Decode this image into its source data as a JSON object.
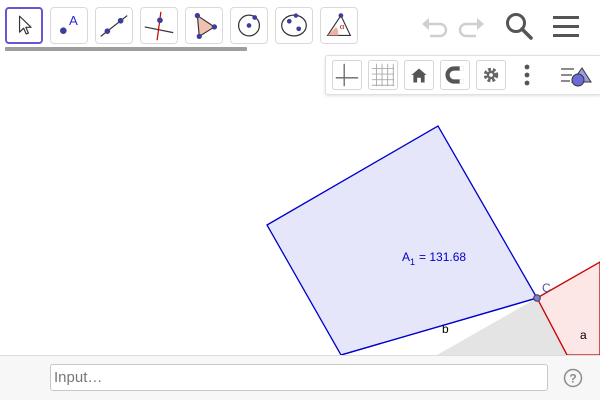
{
  "toolbar": {
    "tools": [
      {
        "name": "move-tool",
        "selected": true
      },
      {
        "name": "point-tool",
        "glyph": "A"
      },
      {
        "name": "line-tool"
      },
      {
        "name": "perpendicular-line-tool"
      },
      {
        "name": "polygon-tool"
      },
      {
        "name": "circle-center-point-tool"
      },
      {
        "name": "ellipse-tool"
      },
      {
        "name": "angle-tool",
        "glyph": "α"
      }
    ],
    "right_icons": [
      "undo-icon",
      "redo-icon",
      "search-icon",
      "menu-icon"
    ]
  },
  "style_bar": {
    "buttons": [
      "axes-icon",
      "grid-icon",
      "home-icon",
      "magnet-icon",
      "gear-icon",
      "more-icon",
      "style-toggle-icon"
    ]
  },
  "graphics": {
    "colors": {
      "square_fill": "#e6e6fa",
      "square_stroke": "#0000cc",
      "triangle_fill": "#e4e4e4",
      "red_fill": "#fde6e6",
      "red_stroke": "#cc0000",
      "point_fill": "#8080c0"
    },
    "labels": {
      "area_prefix": "A",
      "area_sub": "1",
      "area_value": "= 131.68",
      "point_c": "C",
      "side_b": "b",
      "side_a": "a"
    }
  },
  "input": {
    "placeholder": "Input…",
    "value": ""
  },
  "help": {
    "icon": "help-icon",
    "glyph": "?"
  }
}
